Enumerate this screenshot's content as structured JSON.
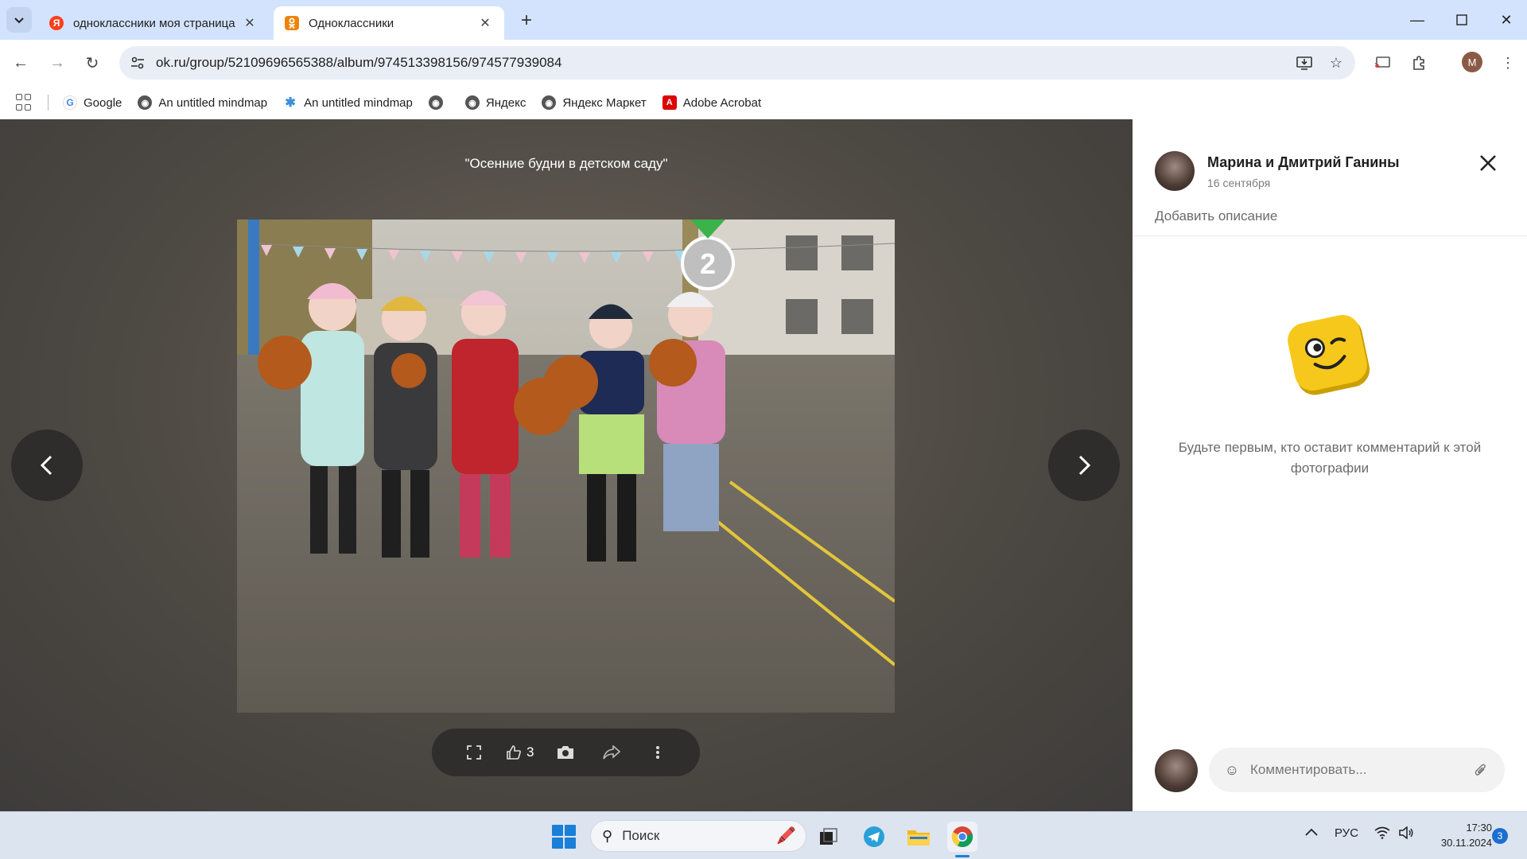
{
  "browser": {
    "tabs": [
      {
        "title": "одноклассники моя страница",
        "favicon": "yandex-favicon",
        "favicon_char": "Я"
      },
      {
        "title": "Одноклассники",
        "favicon": "ok-favicon",
        "favicon_char": "ok",
        "active": true
      }
    ],
    "url": "ok.ru/group/52109696565388/album/974513398156/974577939084",
    "profile_initial": "M",
    "bookmarks": [
      {
        "label": "Google",
        "icon": "google-icon"
      },
      {
        "label": "An untitled mindmap",
        "icon": "globe-icon"
      },
      {
        "label": "An untitled mindmap",
        "icon": "mindmap-icon"
      },
      {
        "label": "",
        "icon": "globe-icon"
      },
      {
        "label": "Яндекс",
        "icon": "globe-icon"
      },
      {
        "label": "Яндекс Маркет",
        "icon": "globe-icon"
      },
      {
        "label": "Adobe Acrobat",
        "icon": "acrobat-icon"
      }
    ]
  },
  "viewer": {
    "album_title": "\"Осенние будни в детском саду\"",
    "photo_badge": "2",
    "likes_count": "3"
  },
  "side_panel": {
    "author_name": "Марина и Дмитрий Ганины",
    "date": "16 сентября",
    "add_description": "Добавить описание",
    "empty_comments": "Будьте первым, кто оставит комментарий к этой фотографии",
    "comment_placeholder": "Комментировать..."
  },
  "taskbar": {
    "search_label": "Поиск",
    "language": "РУС",
    "time": "17:30",
    "date": "30.11.2024",
    "notifications": "3"
  },
  "colors": {
    "ok_orange": "#ee8208",
    "chrome_tabstrip": "#d3e3fd",
    "viewer_bg": "#4d4943",
    "win_accent": "#1a7fd8"
  }
}
